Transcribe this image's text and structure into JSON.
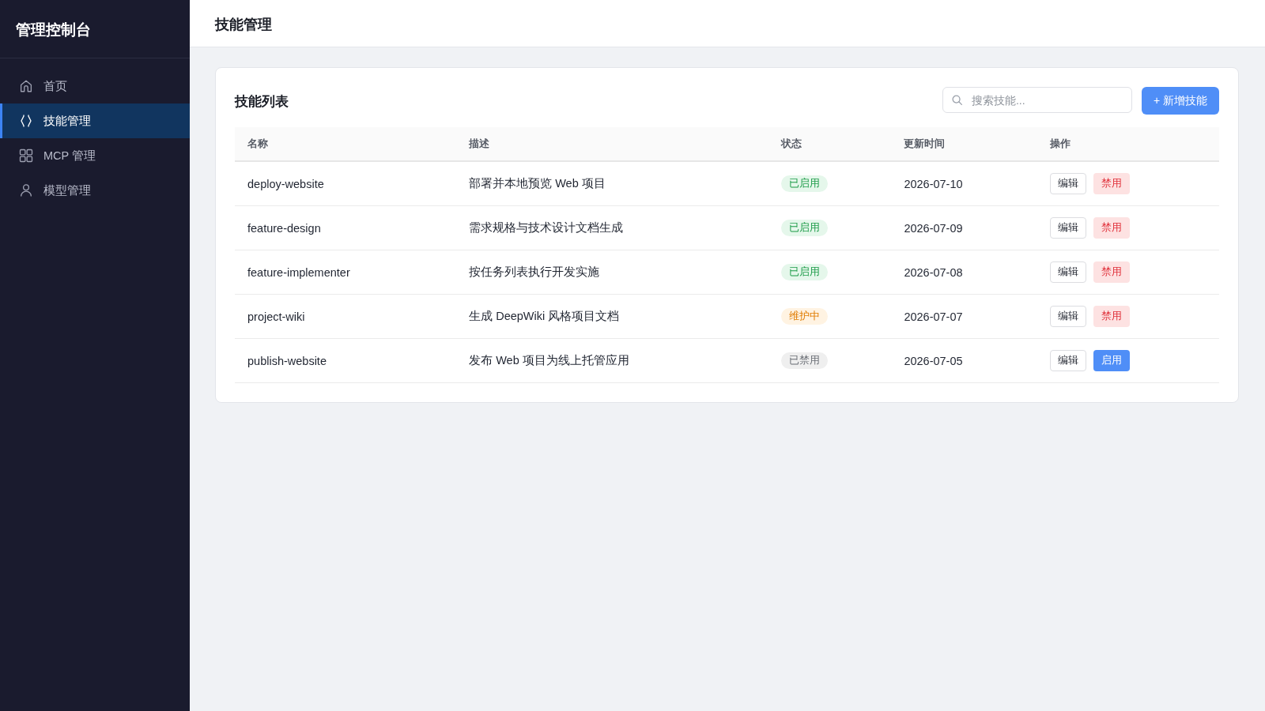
{
  "sidebar": {
    "title": "管理控制台",
    "items": [
      {
        "label": "首页",
        "selected": false
      },
      {
        "label": "技能管理",
        "selected": true
      },
      {
        "label": "MCP 管理",
        "selected": false
      },
      {
        "label": "模型管理",
        "selected": false
      }
    ]
  },
  "header": {
    "title": "技能管理"
  },
  "panel": {
    "title": "技能列表",
    "search": {
      "placeholder": "搜索技能..."
    },
    "add_button": "+ 新增技能",
    "table": {
      "columns": [
        "名称",
        "描述",
        "状态",
        "更新时间",
        "操作"
      ],
      "rows": [
        {
          "name": "deploy-website",
          "description": "部署并本地预览 Web 项目",
          "status": {
            "label": "已启用",
            "kind": "enabled"
          },
          "updated": "2026-07-10",
          "actions": [
            {
              "label": "编辑",
              "kind": "edit"
            },
            {
              "label": "禁用",
              "kind": "danger"
            }
          ]
        },
        {
          "name": "feature-design",
          "description": "需求规格与技术设计文档生成",
          "status": {
            "label": "已启用",
            "kind": "enabled"
          },
          "updated": "2026-07-09",
          "actions": [
            {
              "label": "编辑",
              "kind": "edit"
            },
            {
              "label": "禁用",
              "kind": "danger"
            }
          ]
        },
        {
          "name": "feature-implementer",
          "description": "按任务列表执行开发实施",
          "status": {
            "label": "已启用",
            "kind": "enabled"
          },
          "updated": "2026-07-08",
          "actions": [
            {
              "label": "编辑",
              "kind": "edit"
            },
            {
              "label": "禁用",
              "kind": "danger"
            }
          ]
        },
        {
          "name": "project-wiki",
          "description": "生成 DeepWiki 风格项目文档",
          "status": {
            "label": "维护中",
            "kind": "maintenance"
          },
          "updated": "2026-07-07",
          "actions": [
            {
              "label": "编辑",
              "kind": "edit"
            },
            {
              "label": "禁用",
              "kind": "danger"
            }
          ]
        },
        {
          "name": "publish-website",
          "description": "发布 Web 项目为线上托管应用",
          "status": {
            "label": "已禁用",
            "kind": "disabled"
          },
          "updated": "2026-07-05",
          "actions": [
            {
              "label": "编辑",
              "kind": "edit"
            },
            {
              "label": "启用",
              "kind": "primary"
            }
          ]
        }
      ]
    }
  }
}
